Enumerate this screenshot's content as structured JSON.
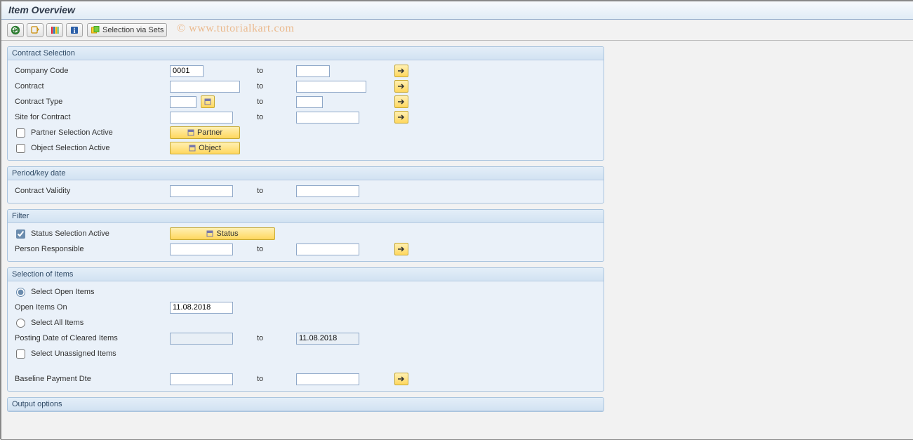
{
  "title": "Item Overview",
  "toolbar": {
    "selection_via_sets": "Selection via Sets"
  },
  "watermark": "© www.tutorialkart.com",
  "to_label": "to",
  "groups": {
    "contract_selection": {
      "title": "Contract Selection",
      "company_code": {
        "label": "Company Code",
        "from": "0001",
        "to": ""
      },
      "contract": {
        "label": "Contract",
        "from": "",
        "to": ""
      },
      "contract_type": {
        "label": "Contract Type",
        "from": "",
        "to": ""
      },
      "site": {
        "label": "Site for Contract",
        "from": "",
        "to": ""
      },
      "partner_sel": {
        "label": "Partner Selection Active",
        "checked": false,
        "button": "Partner"
      },
      "object_sel": {
        "label": "Object Selection Active",
        "checked": false,
        "button": "Object"
      }
    },
    "period": {
      "title": "Period/key date",
      "validity": {
        "label": "Contract Validity",
        "from": "",
        "to": ""
      }
    },
    "filter": {
      "title": "Filter",
      "status_sel": {
        "label": "Status Selection Active",
        "checked": true,
        "button": "Status"
      },
      "person": {
        "label": "Person Responsible",
        "from": "",
        "to": ""
      }
    },
    "items": {
      "title": "Selection of Items",
      "open_items": {
        "label": "Select Open Items",
        "selected": true
      },
      "open_on": {
        "label": "Open Items On",
        "value": "11.08.2018"
      },
      "all_items": {
        "label": "Select All Items",
        "selected": false
      },
      "posting_date": {
        "label": "Posting Date of Cleared Items",
        "from": "",
        "to": "11.08.2018"
      },
      "unassigned": {
        "label": "Select Unassigned Items",
        "checked": false
      },
      "baseline": {
        "label": "Baseline Payment Dte",
        "from": "",
        "to": ""
      }
    },
    "output": {
      "title": "Output options"
    }
  }
}
